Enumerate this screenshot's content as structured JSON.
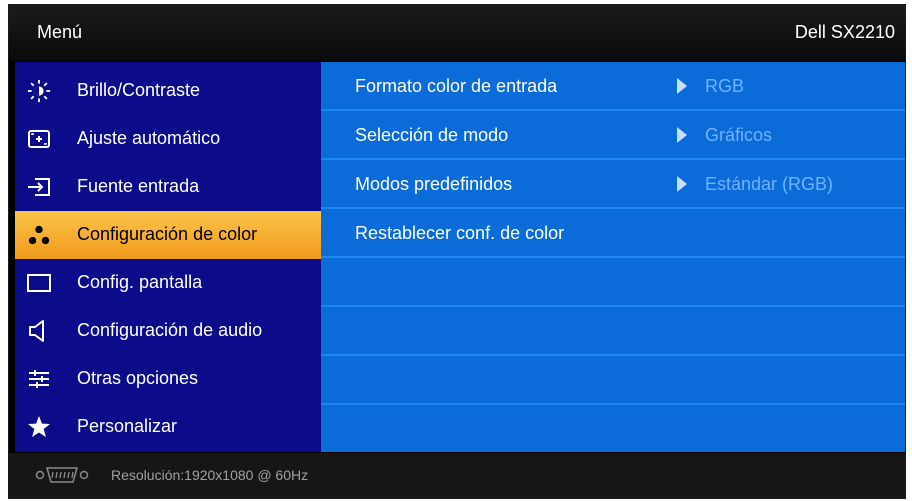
{
  "header": {
    "title": "Menú",
    "model": "Dell SX2210"
  },
  "sidebar": {
    "items": [
      {
        "label": "Brillo/Contraste",
        "icon": "brightness-icon"
      },
      {
        "label": "Ajuste automático",
        "icon": "auto-adjust-icon"
      },
      {
        "label": "Fuente entrada",
        "icon": "input-source-icon"
      },
      {
        "label": "Configuración de color",
        "icon": "color-dots-icon",
        "active": true
      },
      {
        "label": "Config. pantalla",
        "icon": "display-icon"
      },
      {
        "label": "Configuración de audio",
        "icon": "speaker-icon"
      },
      {
        "label": "Otras opciones",
        "icon": "sliders-icon"
      },
      {
        "label": "Personalizar",
        "icon": "star-icon"
      }
    ]
  },
  "content": {
    "rows": [
      {
        "label": "Formato color de entrada",
        "value": "RGB"
      },
      {
        "label": "Selección de modo",
        "value": "Gráficos"
      },
      {
        "label": "Modos predefinidos",
        "value": "Estándar (RGB)"
      },
      {
        "label": "Restablecer conf. de color",
        "value": ""
      }
    ]
  },
  "footer": {
    "resolution": "Resolución:1920x1080 @ 60Hz",
    "connector_icon": "vga-icon"
  },
  "colors": {
    "sidebar_bg": "#0c0c8a",
    "content_bg": "#0b6bd9",
    "active_item": "#f5a623",
    "value_text": "#6fb2ff"
  }
}
